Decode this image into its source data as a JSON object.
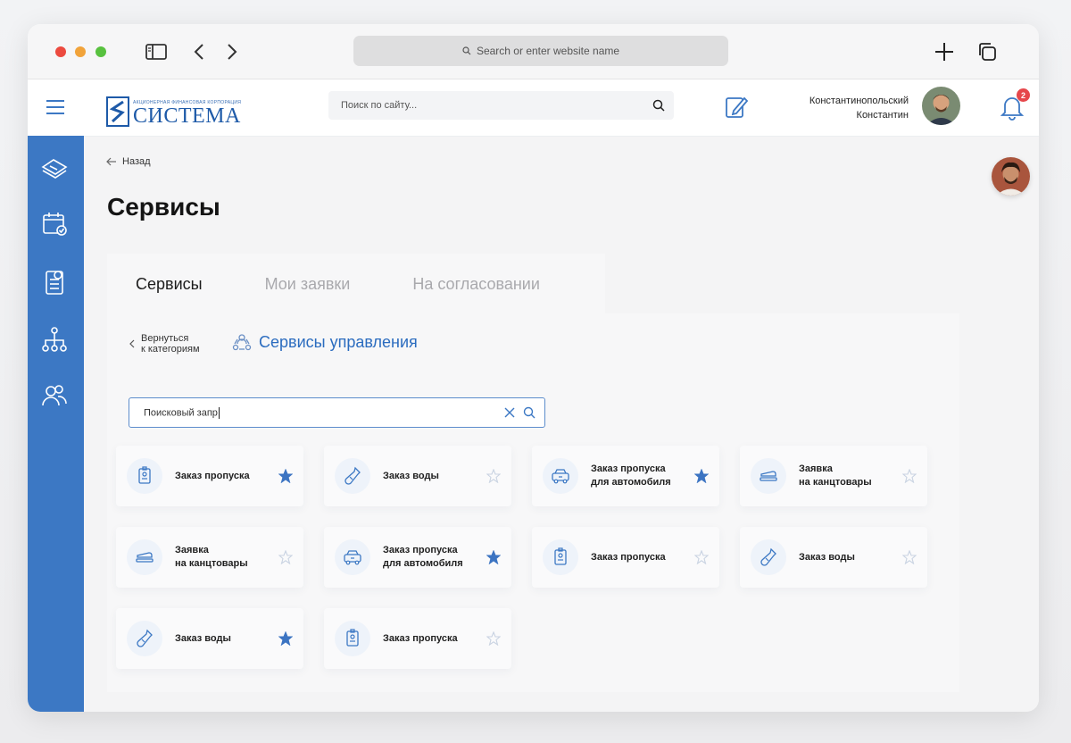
{
  "browser": {
    "address_placeholder": "Search or enter website name"
  },
  "header": {
    "logo_small": "АКЦИОНЕРНАЯ ФИНАНСОВАЯ КОРПОРАЦИЯ",
    "logo_big": "СИСТЕМА",
    "search_placeholder": "Поиск по сайту...",
    "user_first": "Константинопольский",
    "user_last": "Константин",
    "notifications_count": "2"
  },
  "page": {
    "back_label": "Назад",
    "title": "Сервисы"
  },
  "tabs": [
    {
      "label": "Сервисы",
      "active": true
    },
    {
      "label": "Мои заявки",
      "active": false
    },
    {
      "label": "На согласовании",
      "active": false
    }
  ],
  "category": {
    "back_line1": "Вернуться",
    "back_line2": "к категориям",
    "title": "Сервисы управления"
  },
  "query": {
    "value": "Поисковый запр"
  },
  "colors": {
    "accent": "#3c78c4",
    "star_filled": "#3c74c2",
    "star_empty": "#c9d3e2"
  },
  "services": [
    {
      "label": "Заказ пропуска",
      "icon": "badge-icon",
      "favorite": true
    },
    {
      "label": "Заказ воды",
      "icon": "water-bottle-icon",
      "favorite": false
    },
    {
      "label": "Заказ пропуска\nдля автомобиля",
      "icon": "car-icon",
      "favorite": true
    },
    {
      "label": "Заявка\nна канцтовары",
      "icon": "stapler-icon",
      "favorite": false
    },
    {
      "label": "Заявка\nна канцтовары",
      "icon": "stapler-icon",
      "favorite": false
    },
    {
      "label": "Заказ пропуска\nдля автомобиля",
      "icon": "car-icon",
      "favorite": true
    },
    {
      "label": "Заказ пропуска",
      "icon": "badge-icon",
      "favorite": false
    },
    {
      "label": "Заказ воды",
      "icon": "water-bottle-icon",
      "favorite": false
    },
    {
      "label": "Заказ воды",
      "icon": "water-bottle-icon",
      "favorite": true
    },
    {
      "label": "Заказ пропуска",
      "icon": "badge-icon",
      "favorite": false
    }
  ]
}
